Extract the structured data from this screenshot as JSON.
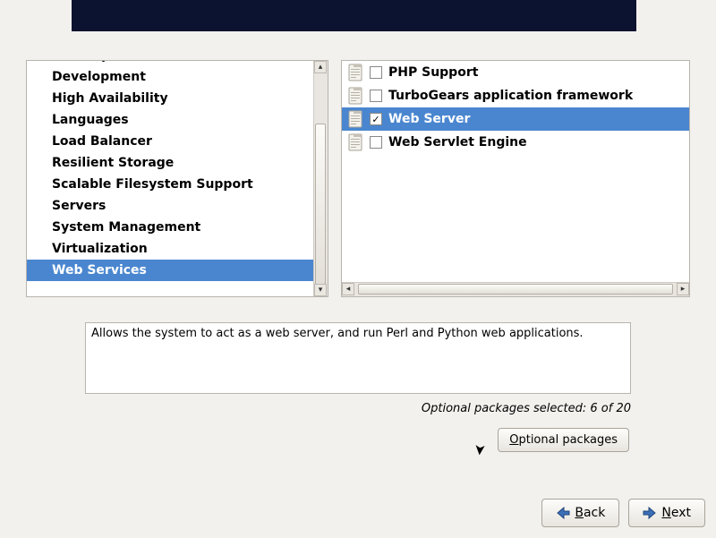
{
  "categories": [
    {
      "label": "Desktops",
      "selected": false
    },
    {
      "label": "Development",
      "selected": false
    },
    {
      "label": "High Availability",
      "selected": false
    },
    {
      "label": "Languages",
      "selected": false
    },
    {
      "label": "Load Balancer",
      "selected": false
    },
    {
      "label": "Resilient Storage",
      "selected": false
    },
    {
      "label": "Scalable Filesystem Support",
      "selected": false
    },
    {
      "label": "Servers",
      "selected": false
    },
    {
      "label": "System Management",
      "selected": false
    },
    {
      "label": "Virtualization",
      "selected": false
    },
    {
      "label": "Web Services",
      "selected": true
    }
  ],
  "packages": [
    {
      "label": "PHP Support",
      "checked": false,
      "selected": false
    },
    {
      "label": "TurboGears application framework",
      "checked": false,
      "selected": false
    },
    {
      "label": "Web Server",
      "checked": true,
      "selected": true
    },
    {
      "label": "Web Servlet Engine",
      "checked": false,
      "selected": false
    }
  ],
  "description": "Allows the system to act as a web server, and run Perl and Python web applications.",
  "optional_count_text": "Optional packages selected: 6 of 20",
  "buttons": {
    "optional": "Optional packages",
    "optional_ul": "O",
    "back": "Back",
    "back_ul": "B",
    "next": "Next",
    "next_ul": "N"
  }
}
